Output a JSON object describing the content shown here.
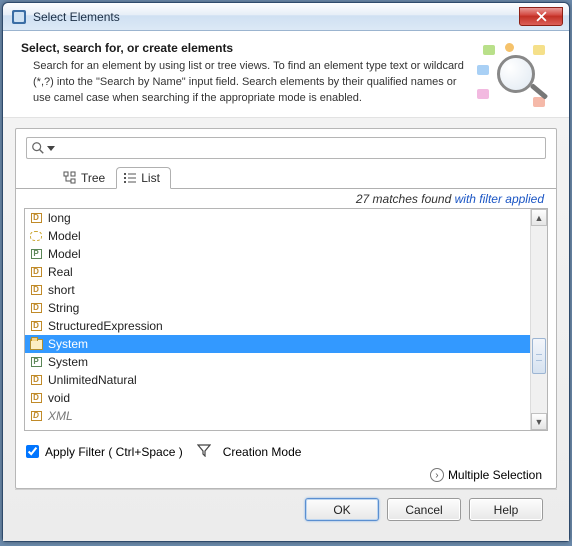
{
  "window": {
    "title": "Select Elements"
  },
  "header": {
    "heading": "Select, search for, or create elements",
    "description": "Search for an element by using list or tree views. To find an element type text or wildcard (*,?) into the \"Search by Name\" input field. Search elements by their qualified names or use camel case when searching if the appropriate mode is enabled."
  },
  "search": {
    "value": "",
    "placeholder": ""
  },
  "tabs": {
    "tree": "Tree",
    "list": "List"
  },
  "status": {
    "count": "27 matches found ",
    "filter_link": "with filter applied"
  },
  "list": {
    "items": [
      {
        "label": "long",
        "icon": "d",
        "italic": false,
        "selected": false
      },
      {
        "label": "Model",
        "icon": "dots",
        "italic": false,
        "selected": false
      },
      {
        "label": "Model",
        "icon": "p",
        "italic": false,
        "selected": false
      },
      {
        "label": "Real",
        "icon": "d",
        "italic": false,
        "selected": false
      },
      {
        "label": "short",
        "icon": "d",
        "italic": false,
        "selected": false
      },
      {
        "label": "String",
        "icon": "d",
        "italic": false,
        "selected": false
      },
      {
        "label": "StructuredExpression",
        "icon": "d",
        "italic": false,
        "selected": false
      },
      {
        "label": "System",
        "icon": "pkg",
        "italic": false,
        "selected": true
      },
      {
        "label": "System",
        "icon": "p",
        "italic": false,
        "selected": false
      },
      {
        "label": "UnlimitedNatural",
        "icon": "d",
        "italic": false,
        "selected": false
      },
      {
        "label": "void",
        "icon": "d",
        "italic": false,
        "selected": false
      },
      {
        "label": "XML",
        "icon": "d",
        "italic": true,
        "selected": false
      }
    ]
  },
  "options": {
    "apply_filter_label": "Apply Filter ( Ctrl+Space )",
    "apply_filter_checked": true,
    "creation_mode_label": "Creation Mode"
  },
  "multiple_selection_label": "Multiple Selection",
  "buttons": {
    "ok": "OK",
    "cancel": "Cancel",
    "help": "Help"
  }
}
